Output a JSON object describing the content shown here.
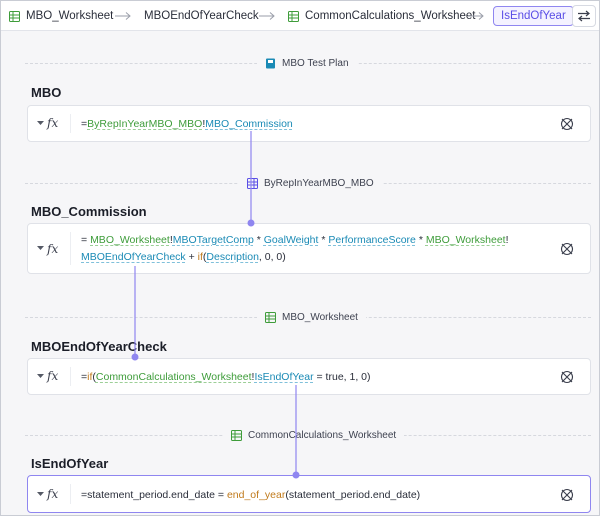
{
  "breadcrumb": {
    "items": [
      {
        "label": "MBO_Worksheet",
        "icon": "worksheet-icon"
      },
      {
        "label": "MBOEndOfYearCheck",
        "icon": "none"
      },
      {
        "label": "CommonCalculations_Worksheet",
        "icon": "worksheet-icon"
      },
      {
        "label": "IsEndOfYear",
        "icon": "none",
        "active": true
      }
    ],
    "swap_icon": "swap-arrows-icon"
  },
  "sections": [
    {
      "source_label": "MBO Test Plan",
      "source_icon": "book-icon",
      "name": "MBO",
      "formula": [
        [
          "op",
          "="
        ],
        [
          "fn",
          "ByRepInYearMBO_MBO"
        ],
        [
          "op",
          "!"
        ],
        [
          "ref",
          "MBO_Commission"
        ]
      ]
    },
    {
      "source_label": "ByRepInYearMBO_MBO",
      "source_icon": "cube-icon",
      "name": "MBO_Commission",
      "formula_lines": [
        [
          [
            "op",
            "= "
          ],
          [
            "fn",
            "MBO_Worksheet"
          ],
          [
            "op",
            "!"
          ],
          [
            "ref",
            "MBOTargetComp"
          ],
          [
            "op",
            " * "
          ],
          [
            "ref",
            "GoalWeight"
          ],
          [
            "op",
            " * "
          ],
          [
            "ref",
            "PerformanceScore"
          ],
          [
            "op",
            " * "
          ],
          [
            "fn",
            "MBO_Worksheet"
          ],
          [
            "op",
            "!"
          ]
        ],
        [
          [
            "ref",
            "MBOEndOfYearCheck"
          ],
          [
            "op",
            " + "
          ],
          [
            "kw",
            "if"
          ],
          [
            "op",
            "("
          ],
          [
            "ref",
            "Description"
          ],
          [
            "op",
            ", 0, 0)"
          ]
        ]
      ]
    },
    {
      "source_label": "MBO_Worksheet",
      "source_icon": "worksheet-icon",
      "name": "MBOEndOfYearCheck",
      "formula": [
        [
          "op",
          "="
        ],
        [
          "kw",
          "if"
        ],
        [
          "op",
          "("
        ],
        [
          "fn",
          "CommonCalculations_Worksheet"
        ],
        [
          "op",
          "!"
        ],
        [
          "ref",
          "IsEndOfYear"
        ],
        [
          "op",
          " = true, 1, 0)"
        ]
      ]
    },
    {
      "source_label": "CommonCalculations_Worksheet",
      "source_icon": "worksheet-icon",
      "name": "IsEndOfYear",
      "formula": [
        [
          "op",
          "=statement_period.end_date = "
        ],
        [
          "kw",
          "end_of_year"
        ],
        [
          "op",
          "(statement_period.end_date)"
        ]
      ]
    }
  ],
  "colors": {
    "accent": "#8f86f0",
    "reference": "#1a8ab5",
    "sheet": "#3e9c3a",
    "function": "#c07a1b"
  }
}
